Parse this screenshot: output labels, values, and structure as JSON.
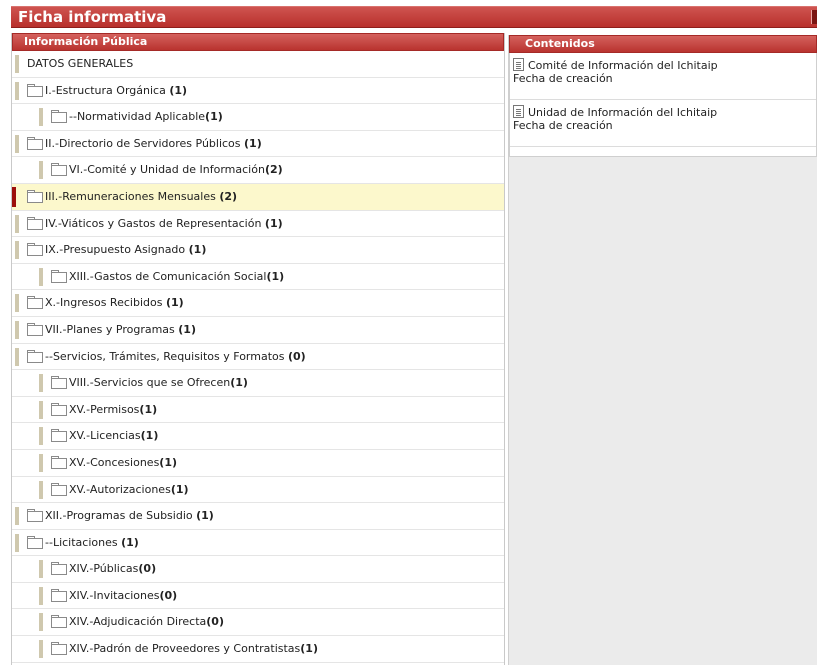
{
  "window": {
    "title": "Ficha informativa"
  },
  "left_panel": {
    "header": "Información Pública",
    "items": [
      {
        "label": "DATOS GENERALES",
        "count": null,
        "level": 0,
        "folder": false
      },
      {
        "label": "I.-Estructura Orgánica ",
        "count": "(1)",
        "level": 0,
        "folder": true
      },
      {
        "label": "--Normatividad Aplicable",
        "count": "(1)",
        "level": 1,
        "folder": true
      },
      {
        "label": "II.-Directorio de Servidores Públicos ",
        "count": "(1)",
        "level": 0,
        "folder": true
      },
      {
        "label": "VI.-Comité y Unidad de Información",
        "count": "(2)",
        "level": 1,
        "folder": true
      },
      {
        "label": "III.-Remuneraciones Mensuales ",
        "count": "(2)",
        "level": 0,
        "folder": true,
        "selected": true
      },
      {
        "label": "IV.-Viáticos y Gastos de Representación ",
        "count": "(1)",
        "level": 0,
        "folder": true
      },
      {
        "label": "IX.-Presupuesto Asignado ",
        "count": "(1)",
        "level": 0,
        "folder": true
      },
      {
        "label": "XIII.-Gastos de Comunicación Social",
        "count": "(1)",
        "level": 1,
        "folder": true
      },
      {
        "label": "X.-Ingresos Recibidos ",
        "count": "(1)",
        "level": 0,
        "folder": true
      },
      {
        "label": "VII.-Planes y Programas ",
        "count": "(1)",
        "level": 0,
        "folder": true
      },
      {
        "label": "--Servicios, Trámites, Requisitos y Formatos ",
        "count": "(0)",
        "level": 0,
        "folder": true
      },
      {
        "label": "VIII.-Servicios que se Ofrecen",
        "count": "(1)",
        "level": 1,
        "folder": true
      },
      {
        "label": "XV.-Permisos",
        "count": "(1)",
        "level": 1,
        "folder": true
      },
      {
        "label": "XV.-Licencias",
        "count": "(1)",
        "level": 1,
        "folder": true
      },
      {
        "label": "XV.-Concesiones",
        "count": "(1)",
        "level": 1,
        "folder": true
      },
      {
        "label": "XV.-Autorizaciones",
        "count": "(1)",
        "level": 1,
        "folder": true
      },
      {
        "label": "XII.-Programas de Subsidio ",
        "count": "(1)",
        "level": 0,
        "folder": true
      },
      {
        "label": "--Licitaciones ",
        "count": "(1)",
        "level": 0,
        "folder": true
      },
      {
        "label": "XIV.-Públicas",
        "count": "(0)",
        "level": 1,
        "folder": true
      },
      {
        "label": "XIV.-Invitaciones",
        "count": "(0)",
        "level": 1,
        "folder": true
      },
      {
        "label": "XIV.-Adjudicación Directa",
        "count": "(0)",
        "level": 1,
        "folder": true
      },
      {
        "label": "XIV.-Padrón de Proveedores y Contratistas",
        "count": "(1)",
        "level": 1,
        "folder": true
      }
    ]
  },
  "right_panel": {
    "header": "Contenidos",
    "items": [
      {
        "title": "Comité de Información del Ichitaip",
        "subtitle": "Fecha de creación",
        "icon": "document-icon"
      },
      {
        "title": "Unidad de Información del Ichitaip",
        "subtitle": "Fecha de creación",
        "icon": "document-icon"
      }
    ]
  },
  "colors": {
    "header_red": "#b8302c",
    "selected_row": "#fcf8cc",
    "selected_marker": "#9c0e0a",
    "tree_marker": "#cfc8ae"
  }
}
